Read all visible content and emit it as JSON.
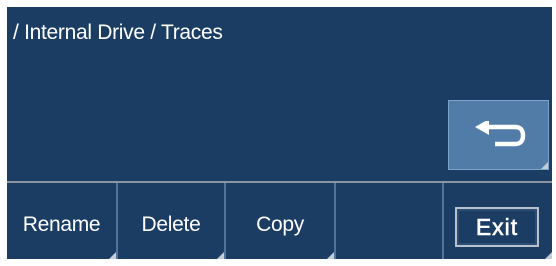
{
  "header": {
    "path": "/ Internal Drive / Traces"
  },
  "back_button": {
    "icon": "return-arrow-icon"
  },
  "softkeys": [
    {
      "label": "Rename"
    },
    {
      "label": "Delete"
    },
    {
      "label": "Copy"
    },
    {
      "label": ""
    },
    {
      "label": "Exit"
    }
  ],
  "colors": {
    "panel_background": "#1b3d63",
    "back_button_background": "#527ca8",
    "text": "#ffffff"
  }
}
